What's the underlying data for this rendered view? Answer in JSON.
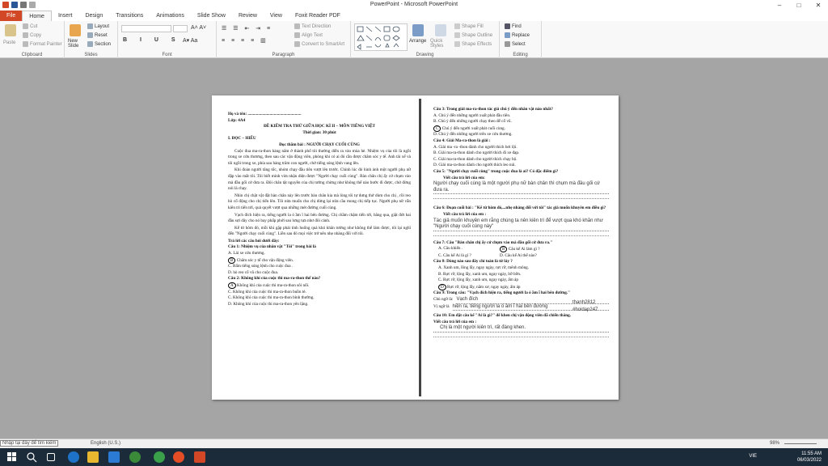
{
  "window": {
    "title": "PowerPoint - Microsoft PowerPoint"
  },
  "tabs": [
    "File",
    "Home",
    "Insert",
    "Design",
    "Transitions",
    "Animations",
    "Slide Show",
    "Review",
    "View",
    "Foxit Reader PDF"
  ],
  "ribbon": {
    "clipboard": {
      "paste": "Paste",
      "cut": "Cut",
      "copy": "Copy",
      "format_painter": "Format Painter",
      "label": "Clipboard"
    },
    "slides": {
      "new_slide": "New Slide",
      "layout": "Layout",
      "reset": "Reset",
      "section": "Section",
      "label": "Slides"
    },
    "font": {
      "label": "Font"
    },
    "paragraph": {
      "text_direction": "Text Direction",
      "align_text": "Align Text",
      "convert_smartart": "Convert to SmartArt",
      "label": "Paragraph"
    },
    "drawing": {
      "arrange": "Arrange",
      "quick_styles": "Quick Styles",
      "shape_fill": "Shape Fill",
      "shape_outline": "Shape Outline",
      "shape_effects": "Shape Effects",
      "label": "Drawing"
    },
    "editing": {
      "find": "Find",
      "replace": "Replace",
      "select": "Select",
      "label": "Editing"
    }
  },
  "doc": {
    "name_line": "Họ và tên: ...................................................",
    "class_line": "Lớp: 4A4",
    "title": "ĐỀ KIỂM TRA THỨ GIỮA HỌC KÌ II – MÔN TIẾNG VIỆT",
    "time": "Thời gian: 30 phút",
    "section1": "I. ĐỌC – HIỂU",
    "reading_title": "Đọc thầm bài : NGƯỜI CHẠY CUỐI CÙNG",
    "para1": "Cuộc đua ma-ra-thon hàng năm ở thành phố tôi thường diễn ra vào mùa hè. Nhiệm vụ của tôi là ngồi trong xe cứu thương, theo sau các vận động viên, phòng khi có ai đó cần được chăm sóc y tế. Anh tài xế và tôi ngồi trong xe, phía sau hàng trăm con người, chờ tiếng súng lệnh vang lên.",
    "para2": "Khi đoàn người tăng tốc, nhóm chạy đầu tiên vượt lên trước. Chính lúc đó hình ảnh một người phụ nữ đập vào mắt tôi. Tôi biết mình vừa nhận diện được \"Người chạy cuối cùng\". Bàn chân chị ấy cứ chụm vào mà đầu gối cứ đưa ra. Đôi chân tật nguyền của chị tưởng chừng như không thể nào bước đi được, chứ đừng nói là chạy.",
    "para3": "Nhìn chị chật vật đặt bàn chân này lên trước bàn chân kia mà lòng tôi tự dưng thở dùm cho chị , rồi reo hò cổ động cho chị tiến lên. Tôi nửa muốn cho chị dừng lại nửa cầu mong chị tiếp tục. Người phụ nữ vẫn kiên trì tiến tới, quả quyết vượt qua những mét đường cuối cùng.",
    "para4": "Vạch đích hiện ra, tiếng người la ó ầm ĩ hai bên đường. Chị chầm chậm tiến tới, băng qua, giật đứt hai đầu sợi dây cho nó bay phấp phới sau lưng tựa như đôi cánh.",
    "para5": "Kể từ hôm đó, mỗi khi gặp phải tình huống quá khó khăn tưởng như không thể làm được, tôi lại nghĩ đến \"Người chạy cuối cùng\". Liền sau đó mọi việc trở nên nhẹ nhàng đối với tôi.",
    "answer_prompt": "Trả lời các câu hỏi dưới đây:",
    "q1": "Câu 1: Nhiệm vụ của nhân vật \"Tôi\" trong bài là",
    "q1a": "A. Lái xe cứu thương.",
    "q1b": "Chăm sóc y tế cho vận động viên.",
    "q1b_letter": "B",
    "q1c": "C. Bấm tiếng súng lệnh cho cuộc đua .",
    "q1d": "D. hò reo cổ vũ cho cuộc đua.",
    "q2": "Câu 2: Không khí của cuộc thi ma-ra-thon thế nào?",
    "q2a": "Không khí của cuộc thi ma-ra-thon sôi nổi.",
    "q2a_letter": "A",
    "q2b": "C. Không khí của cuộc thi ma-ra-thon buồn tẻ.",
    "q2c": "C. Không khí của cuộc thi ma-ra-thon bình thường.",
    "q2d": "D. Không khí của cuộc thi ma-ra-thon yên lặng.",
    "q3": "Câu 3: Trong giải ma-ra-thon tác giả chú ý đến nhân vật nào nhất?",
    "q3a": "A. Chú ý đến những người xuất phát đầu tiên.",
    "q3b": "B. Chú ý đến những người chạy theo để cổ vũ.",
    "q3c": "Chú ý đến người xuất phát cuối cùng.",
    "q3c_letter": "C",
    "q3d": "D. Chú ý đến những người trên xe cứu thương.",
    "q4": "Câu 4: Giải Ma-ra-thon là giải :",
    "q4a": "A. Giải ma -ra -thon dành cho người thích bơi lội.",
    "q4b": "B. Giải ma-ra-thon dành cho người thích đi xe đạp.",
    "q4c": "C. Giải ma-ra-thon dành cho người thích chạy bộ.",
    "q4d": "D. Giải ma-ra-thon dành cho người thích leo núi.",
    "q5": "Câu 5: \"Người chạy cuối cùng\" trong cuộc đua là ai? Có đặc điểm gì?",
    "write_prompt": "Viết câu trả lời của em:",
    "a5": "Người chạy cuối cùng là một người phụ nữ bàn chân thì chụm mà đầu gối cứ đưa ra.",
    "q6": "Câu 6: Đoạn cuối bài : \"Kể từ hôm đó,...nhẹ nhàng đối với tôi\" tác giả muốn khuyên em điều gì?",
    "write_prompt2": "Viết câu trả lời của em :",
    "a6": "Tác giả muốn khuyên em rằng chúng ta nên kiên trì để vượt qua khó khăn như \"Người chạy cuối cùng này\"",
    "q7": "Câu 7: Câu \"Bàn chân chị ấy cứ chụm vào mà đầu gối cứ đưa ra.\"",
    "q7a": "A. Câu khiến .",
    "q7b": "Câu kể Ai làm gì ?",
    "q7b_letter": "B",
    "q7c": "C. Câu kể Ai là gì ?",
    "q7d": "D. Câu kể Ai thế nào?",
    "q8": "Câu 8: Dòng nào sau đây chỉ toàn là từ láy ?",
    "q8a": "A. Xanh um, lồng lẫy, ngay ngày, rực rỡ, mênh mông.",
    "q8b": "B. Rực rỡ, lộng lẫy, xanh um, ngay ngày, bỡ bỡn.",
    "q8c": "C. Rực rỡ, lộng lẫy, xanh um, ngay ngày, ấm áp",
    "q8d": "Rực rỡ, lộng lẫy, nắm xơ, ngay ngày, ấm áp",
    "q8d_letter": "D",
    "q9": "Câu 9: Trong câu: \"Vạch đích hiện ra, tiếng người la ó ầm ĩ hai bên đường.\"",
    "q9_cn_label": "Chủ ngữ là:",
    "q9_cn": "Vạch đích",
    "q9_vn_label": "Vị ngữ là",
    "q9_vn": "hiện ra, tiếng người la ó ầm ĩ hai bên đường",
    "q10": "Câu 10: Em đặt câu kể \"Ai là gì?\" để khen chị vận động viên đã chiến thắng.",
    "write_prompt3": "Viết câu trả lời của em :",
    "a10": "Chị là một người kiên trì, rất đáng khen."
  },
  "side_note": {
    "line1": "thanh2812",
    "line2": "#hoidap247"
  },
  "statusbar": {
    "tooltip": "Nhập tại đây để tìm kiếm",
    "language": "English (U.S.)",
    "zoom": "98%"
  },
  "taskbar": {
    "lang": "VIE",
    "time": "11:55 AM",
    "date": "06/03/2022"
  }
}
